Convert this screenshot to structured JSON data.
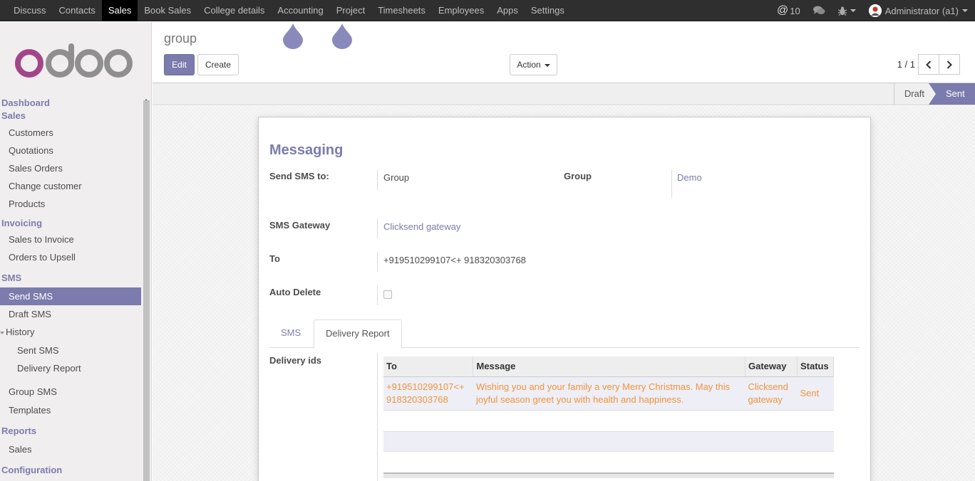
{
  "topbar": {
    "menu": [
      "Discuss",
      "Contacts",
      "Sales",
      "Book Sales",
      "College details",
      "Accounting",
      "Project",
      "Timesheets",
      "Employees",
      "Apps",
      "Settings"
    ],
    "active": "Sales",
    "notifications_count": "10",
    "user": "Administrator (a1)"
  },
  "sidebar": {
    "sections": [
      {
        "header": "Dashboard"
      },
      {
        "header": "Sales",
        "items": [
          "Customers",
          "Quotations",
          "Sales Orders",
          "Change customer",
          "Products"
        ]
      },
      {
        "header": "Invoicing",
        "items": [
          "Sales to Invoice",
          "Orders to Upsell"
        ]
      },
      {
        "header": "SMS",
        "items": [
          "Send SMS",
          "Draft SMS"
        ]
      }
    ],
    "history": "History",
    "history_items": [
      "Sent SMS",
      "Delivery Report"
    ],
    "sms_more": [
      "Group SMS",
      "Templates"
    ],
    "reports": "Reports",
    "reports_items": [
      "Sales"
    ],
    "configuration": "Configuration",
    "active_item": "Send SMS"
  },
  "control_panel": {
    "title": "group",
    "edit": "Edit",
    "create": "Create",
    "action": "Action",
    "pager": "1 / 1"
  },
  "status": {
    "draft": "Draft",
    "sent": "Sent",
    "current": "Sent"
  },
  "form": {
    "title": "Messaging",
    "send_to_label": "Send SMS to:",
    "send_to_value": "Group",
    "group_label": "Group",
    "group_value": "Demo",
    "gateway_label": "SMS Gateway",
    "gateway_value": "Clicksend gateway",
    "to_label": "To",
    "to_value": "+919510299107<+ 918320303768",
    "auto_delete_label": "Auto Delete",
    "auto_delete_checked": false
  },
  "tabs": {
    "sms": "SMS",
    "delivery": "Delivery Report",
    "active": "Delivery Report"
  },
  "delivery": {
    "label": "Delivery ids",
    "columns": [
      "To",
      "Message",
      "Gateway",
      "Status"
    ],
    "rows": [
      {
        "to": "+919510299107<+ 918320303768",
        "message": "Wishing you and your family a very Merry Christmas. May this joyful season greet you with health and happiness.",
        "gateway": "Clicksend gateway",
        "status": "Sent"
      }
    ]
  },
  "colors": {
    "brand": "#7c7bad",
    "topbar": "#2f2f2f",
    "row_text": "#f0943a"
  }
}
